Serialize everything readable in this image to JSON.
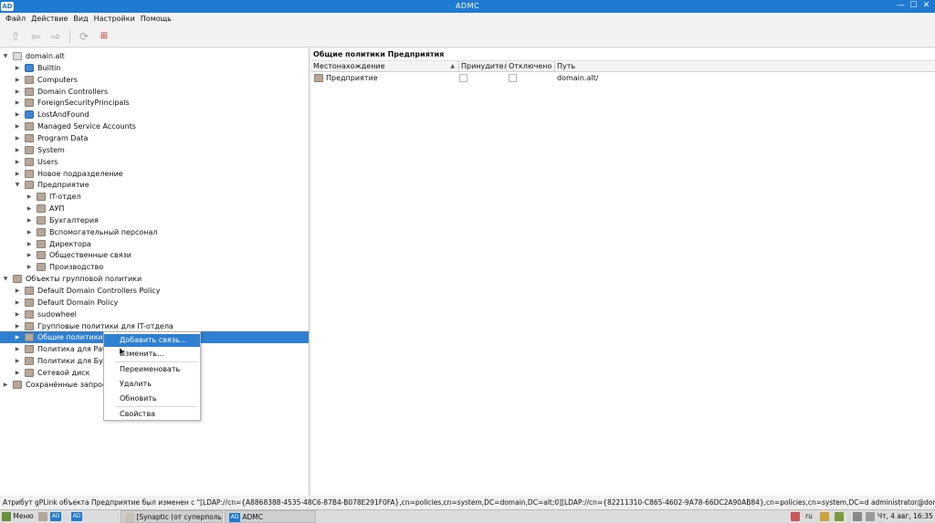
{
  "window": {
    "title": "ADMC",
    "app_badge": "AD",
    "controls": {
      "minimize": "—",
      "maximize": "☐",
      "close": "✕"
    }
  },
  "menubar": [
    "Файл",
    "Действие",
    "Вид",
    "Настройки",
    "Помощь"
  ],
  "toolbar": {
    "icons": [
      "up-icon",
      "back-icon",
      "forward-icon",
      "refresh-icon",
      "manual-icon"
    ],
    "glyphs": {
      "up": "⇧",
      "back": "⇦",
      "forward": "⇨",
      "refresh": "⟳",
      "manual": "⊞"
    }
  },
  "tree": {
    "glyphs": {
      "expanded": "▼",
      "collapsed": "▶"
    },
    "items": [
      {
        "label": "domain.alt",
        "icon": "domain",
        "expanded": true
      },
      {
        "label": "Builtin",
        "icon": "builtin",
        "expanded": false
      },
      {
        "label": "Computers",
        "icon": "folder",
        "expanded": false
      },
      {
        "label": "Domain Controllers",
        "icon": "folder",
        "expanded": false
      },
      {
        "label": "ForeignSecurityPrincipals",
        "icon": "folder",
        "expanded": false
      },
      {
        "label": "LostAndFound",
        "icon": "builtin",
        "expanded": false
      },
      {
        "label": "Managed Service Accounts",
        "icon": "folder",
        "expanded": false
      },
      {
        "label": "Program Data",
        "icon": "folder",
        "expanded": false
      },
      {
        "label": "System",
        "icon": "folder",
        "expanded": false
      },
      {
        "label": "Users",
        "icon": "folder",
        "expanded": false
      },
      {
        "label": "Новое подразделение",
        "icon": "folder",
        "expanded": false
      },
      {
        "label": "Предприятие",
        "icon": "folder",
        "expanded": true
      },
      {
        "label": "IT-отдел",
        "icon": "folder",
        "expanded": false
      },
      {
        "label": "АУП",
        "icon": "folder",
        "expanded": false
      },
      {
        "label": "Бухгалтерия",
        "icon": "folder",
        "expanded": false
      },
      {
        "label": "Вспомогательный персонал",
        "icon": "folder",
        "expanded": false
      },
      {
        "label": "Директора",
        "icon": "folder",
        "expanded": false
      },
      {
        "label": "Общественные связи",
        "icon": "folder",
        "expanded": false
      },
      {
        "label": "Производство",
        "icon": "folder",
        "expanded": false
      },
      {
        "label": "Объекты групповой политики",
        "icon": "folder",
        "expanded": true
      },
      {
        "label": "Default Domain Controllers Policy",
        "icon": "folder",
        "expanded": false
      },
      {
        "label": "Default Domain Policy",
        "icon": "folder",
        "expanded": false
      },
      {
        "label": "sudowheel",
        "icon": "folder",
        "expanded": false
      },
      {
        "label": "Групповые политики для IT-отдела",
        "icon": "folder",
        "expanded": false
      },
      {
        "label": "Общие политики",
        "icon": "folder",
        "expanded": false,
        "selected": true
      },
      {
        "label": "Политика для Рабо",
        "icon": "folder",
        "expanded": false
      },
      {
        "label": "Политики для Бухг",
        "icon": "folder",
        "expanded": false
      },
      {
        "label": "Сетевой диск",
        "icon": "folder",
        "expanded": false
      },
      {
        "label": "Сохранённые запросы",
        "icon": "folder",
        "expanded": false
      }
    ]
  },
  "right_panel": {
    "title": "Общие политики Предприятия",
    "columns": [
      "Местонахождение",
      "Принудитель",
      "Отключено",
      "Путь"
    ],
    "rows": [
      {
        "location": "Предприятие",
        "enforced": false,
        "disabled": false,
        "path": "domain.alt/"
      }
    ]
  },
  "context_menu": {
    "items": [
      "Добавить связь...",
      "Изменить...",
      "Переименовать",
      "Удалить",
      "Обновить",
      "Свойства"
    ],
    "highlighted_index": 0
  },
  "statusbar": {
    "text": "Атрибут gPLink объекта Предприятие был изменен с \"[LDAP://cn={A8868388-4535-48C6-87B4-B078E291F0FA},cn=policies,cn=system,DC=domain,DC=alt;0][LDAP://cn={82211310-C865-4602-9A78-66DC2A90AB84},cn=policies,cn=system,DC=d administrator@domain.alt"
  },
  "taskbar": {
    "menu_label": "Меню",
    "badge1": "AD",
    "badge2": "AD",
    "synaptic_label": "[Synaptic (от суперполь...",
    "admc_badge": "AD",
    "admc_label": "ADMC",
    "lang": "ru",
    "clock": "Чт, 4 авг, 16:35"
  },
  "colors": {
    "accent": "#2f7fd2",
    "titlebar": "#1f7ad1"
  }
}
